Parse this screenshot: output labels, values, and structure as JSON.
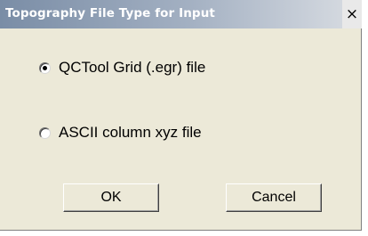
{
  "window": {
    "title": "Topography File Type for Input",
    "close_glyph": "×",
    "close_icon": "close-icon"
  },
  "options": [
    {
      "label": "QCTool Grid (.egr) file",
      "selected": true
    },
    {
      "label": "ASCII column xyz file",
      "selected": false
    }
  ],
  "buttons": {
    "ok_label": "OK",
    "cancel_label": "Cancel"
  }
}
